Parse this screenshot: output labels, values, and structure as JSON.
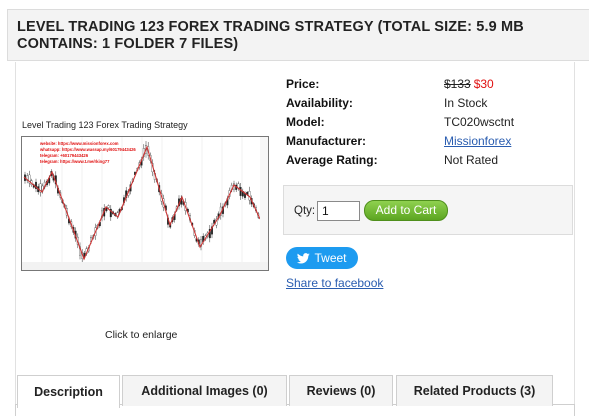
{
  "page": {
    "title": "LEVEL TRADING 123 FOREX TRADING STRATEGY (TOTAL SIZE: 5.9 MB CONTAINS: 1 FOLDER 7 FILES)"
  },
  "product_image": {
    "caption": "Level Trading 123 Forex Trading Strategy",
    "watermark_lines": [
      "website: https://www.missionforex.com",
      "whatsapp: https://www.wassap.my/60179443426",
      "telegram: +60179443426",
      "telegram: https://www.t.me/rking77"
    ],
    "click_to_enlarge": "Click to enlarge"
  },
  "info": {
    "price_label": "Price:",
    "old_price": "$133",
    "new_price": "$30",
    "availability_label": "Availability:",
    "availability": "In Stock",
    "model_label": "Model:",
    "model": "TC020wsctnt",
    "manufacturer_label": "Manufacturer:",
    "manufacturer": "Missionforex",
    "rating_label": "Average Rating:",
    "rating": "Not Rated"
  },
  "cart": {
    "qty_label": "Qty:",
    "qty_value": "1",
    "add_to_cart": "Add to Cart"
  },
  "social": {
    "tweet": "Tweet",
    "share_facebook": "Share to facebook"
  },
  "tabs": [
    {
      "label": "Description",
      "active": true
    },
    {
      "label": "Additional Images (0)",
      "active": false
    },
    {
      "label": "Reviews (0)",
      "active": false
    },
    {
      "label": "Related Products (3)",
      "active": false
    }
  ],
  "colors": {
    "sale_price": "#e01010",
    "link": "#2a5db0",
    "add_to_cart": "#6cb52e",
    "tweet": "#1d9bf0",
    "watermark": "#e01010",
    "zigzag": "#cc3333"
  }
}
